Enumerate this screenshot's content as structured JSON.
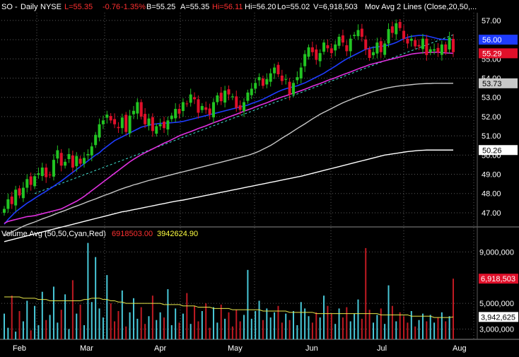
{
  "header": {
    "symbol": "SO",
    "period": "Daily",
    "exchange": "NYSE",
    "last": "L=55.35",
    "change": "-0.76",
    "change_pct": "-1.35%",
    "bid": "B=55.25",
    "ask": "A=55.35",
    "high": "Hi=56.11",
    "hi2": "Hi=56.20",
    "low": "Lo=55.02",
    "volume": "V=6,918,503",
    "mov_avg": "Mov Avg 2 Lines (Close,20,50,..."
  },
  "volume_header": {
    "label": "Volume Avg (50,50,Cyan,Red)",
    "value_red": "6918503.00",
    "value_yellow": "3942624.90"
  },
  "price_axis": {
    "ticks": [
      "57.00",
      "56.00",
      "55.00",
      "54.00",
      "53.00",
      "52.00",
      "51.00",
      "50.00",
      "49.00",
      "48.00",
      "47.00"
    ],
    "markers": [
      {
        "label": "56.00",
        "color": "#1e3cff"
      },
      {
        "label": "55.29",
        "color": "#e0102a"
      },
      {
        "label": "53.73",
        "color": "#c8c8c8"
      },
      {
        "label": "50.26",
        "color": "#ffffff"
      }
    ]
  },
  "volume_axis": {
    "ticks": [
      "9,000,000",
      "5,000,000",
      "3,000,000"
    ],
    "markers": [
      {
        "label": "6,918,503",
        "color": "#e0102a"
      },
      {
        "label": "3,942,625",
        "color": "#ffffff"
      }
    ]
  },
  "x_axis": {
    "labels": [
      "Feb",
      "Mar",
      "Apr",
      "May",
      "Jun",
      "Jul",
      "Aug"
    ]
  },
  "colors": {
    "up": "#22c422",
    "down": "#e0102a",
    "ma20": "#1e3cff",
    "ma50": "#e030e0",
    "ma100": "#c8c8c8",
    "ma200": "#ffffff",
    "trend": "#40e0d0",
    "vol_avg": "#e6e64a",
    "vol_up": "#48c8d8",
    "vol_down": "#c01a22",
    "grid": "#5a5a5a"
  },
  "chart_data": {
    "type": "candlestick",
    "price_range": [
      46.3,
      57.4
    ],
    "volume_range": [
      2200000,
      9900000
    ],
    "closes": [
      47.2,
      47.7,
      47.45,
      48.2,
      47.9,
      48.3,
      48.75,
      48.45,
      48.9,
      49.05,
      49.35,
      48.85,
      48.95,
      49.75,
      50.25,
      49.45,
      49.65,
      50.05,
      49.35,
      49.95,
      49.55,
      49.85,
      50.05,
      50.45,
      51.05,
      51.6,
      51.8,
      52.1,
      51.8,
      51.6,
      51.4,
      51.95,
      51.2,
      52.05,
      52.3,
      52.75,
      52.0,
      51.6,
      51.9,
      51.25,
      51.5,
      51.6,
      51.4,
      51.8,
      52.05,
      52.4,
      52.15,
      52.75,
      52.65,
      53.15,
      52.9,
      52.2,
      52.55,
      52.35,
      52.1,
      52.75,
      53.1,
      52.8,
      53.35,
      53.15,
      53.05,
      52.45,
      52.35,
      52.75,
      53.25,
      53.45,
      53.75,
      54.05,
      53.6,
      53.95,
      54.25,
      54.55,
      54.2,
      53.85,
      53.95,
      53.15,
      53.75,
      54.05,
      54.55,
      55.25,
      55.6,
      55.35,
      54.95,
      55.3,
      55.85,
      55.55,
      55.3,
      55.75,
      56.15,
      55.85,
      55.4,
      56.05,
      56.25,
      56.5,
      56.15,
      55.5,
      55.05,
      55.35,
      55.85,
      55.35,
      55.8,
      56.55,
      56.35,
      56.85,
      56.6,
      56.05,
      55.8,
      56.05,
      55.65,
      55.65,
      56.05,
      55.2,
      55.5,
      55.5,
      55.35,
      55.75,
      55.35,
      56.11,
      55.35
    ],
    "series": [
      {
        "name": "MA 20",
        "values": [
          46.4,
          46.65,
          46.85,
          47.05,
          47.2,
          47.35,
          47.5,
          47.62,
          47.75,
          47.88,
          48.0,
          48.12,
          48.25,
          48.38,
          48.52,
          48.65,
          48.8,
          48.95,
          49.1,
          49.25,
          49.4,
          49.55,
          49.7,
          49.85,
          50.0,
          50.12,
          50.3,
          50.45,
          50.6,
          50.75,
          50.85,
          50.95,
          51.05,
          51.15,
          51.25,
          51.35,
          51.45,
          51.5,
          51.55,
          51.6,
          51.62,
          51.65,
          51.65,
          51.67,
          51.68,
          51.7,
          51.72,
          51.75,
          51.8,
          51.85,
          51.9,
          51.95,
          52.0,
          52.05,
          52.1,
          52.15,
          52.2,
          52.25,
          52.3,
          52.35,
          52.4,
          52.45,
          52.5,
          52.55,
          52.6,
          52.68,
          52.75,
          52.82,
          52.9,
          53.0,
          53.1,
          53.2,
          53.3,
          53.38,
          53.45,
          53.5,
          53.55,
          53.6,
          53.68,
          53.75,
          53.85,
          53.95,
          54.05,
          54.15,
          54.25,
          54.38,
          54.5,
          54.62,
          54.75,
          54.88,
          55.0,
          55.1,
          55.2,
          55.3,
          55.4,
          55.5,
          55.55,
          55.6,
          55.62,
          55.65,
          55.68,
          55.72,
          55.78,
          55.85,
          55.95,
          56.05,
          56.12,
          56.17,
          56.2,
          56.22,
          56.22,
          56.2,
          56.15,
          56.1,
          56.05,
          56.02,
          56.0,
          56.0,
          56.0
        ]
      },
      {
        "name": "MA 50",
        "values": [
          46.45,
          46.55,
          46.6,
          46.65,
          46.7,
          46.75,
          46.8,
          46.82,
          46.85,
          46.9,
          46.95,
          47.0,
          47.05,
          47.1,
          47.15,
          47.2,
          47.3,
          47.4,
          47.5,
          47.6,
          47.72,
          47.85,
          48.0,
          48.15,
          48.3,
          48.45,
          48.6,
          48.75,
          48.9,
          49.05,
          49.2,
          49.35,
          49.5,
          49.65,
          49.78,
          49.9,
          50.02,
          50.12,
          50.22,
          50.32,
          50.42,
          50.52,
          50.62,
          50.7,
          50.8,
          50.9,
          51.0,
          51.08,
          51.15,
          51.22,
          51.3,
          51.38,
          51.45,
          51.52,
          51.6,
          51.68,
          51.75,
          51.82,
          51.9,
          51.98,
          52.05,
          52.12,
          52.2,
          52.28,
          52.35,
          52.42,
          52.5,
          52.58,
          52.65,
          52.72,
          52.8,
          52.88,
          52.95,
          53.02,
          53.08,
          53.15,
          53.22,
          53.28,
          53.35,
          53.42,
          53.5,
          53.58,
          53.65,
          53.72,
          53.8,
          53.88,
          53.95,
          54.02,
          54.1,
          54.18,
          54.25,
          54.32,
          54.4,
          54.48,
          54.55,
          54.62,
          54.7,
          54.75,
          54.8,
          54.85,
          54.9,
          54.95,
          55.0,
          55.05,
          55.1,
          55.15,
          55.2,
          55.25,
          55.28,
          55.3,
          55.32,
          55.33,
          55.34,
          55.35,
          55.35,
          55.33,
          55.31,
          55.3,
          55.29
        ]
      },
      {
        "name": "MA 100",
        "values": [
          45.8,
          45.9,
          46.0,
          46.1,
          46.2,
          46.3,
          46.38,
          46.45,
          46.52,
          46.6,
          46.68,
          46.75,
          46.82,
          46.9,
          46.98,
          47.05,
          47.12,
          47.2,
          47.28,
          47.35,
          47.42,
          47.5,
          47.58,
          47.65,
          47.72,
          47.8,
          47.88,
          47.95,
          48.02,
          48.1,
          48.18,
          48.25,
          48.32,
          48.38,
          48.45,
          48.5,
          48.56,
          48.62,
          48.68,
          48.73,
          48.78,
          48.83,
          48.88,
          48.93,
          48.98,
          49.03,
          49.08,
          49.13,
          49.18,
          49.23,
          49.28,
          49.33,
          49.38,
          49.43,
          49.48,
          49.53,
          49.58,
          49.63,
          49.68,
          49.73,
          49.78,
          49.83,
          49.88,
          49.93,
          49.98,
          50.05,
          50.12,
          50.2,
          50.3,
          50.4,
          50.5,
          50.62,
          50.75,
          50.88,
          51.0,
          51.12,
          51.25,
          51.38,
          51.5,
          51.62,
          51.75,
          51.88,
          52.0,
          52.12,
          52.22,
          52.32,
          52.42,
          52.52,
          52.62,
          52.72,
          52.8,
          52.88,
          52.96,
          53.04,
          53.1,
          53.17,
          53.24,
          53.3,
          53.36,
          53.41,
          53.46,
          53.5,
          53.54,
          53.57,
          53.6,
          53.62,
          53.64,
          53.66,
          53.68,
          53.7,
          53.71,
          53.72,
          53.72,
          53.73,
          53.73,
          53.73,
          53.73,
          53.73,
          53.73
        ]
      },
      {
        "name": "MA 200",
        "values": [
          45.5,
          45.55,
          45.6,
          45.65,
          45.7,
          45.75,
          45.8,
          45.85,
          45.9,
          45.95,
          46.0,
          46.05,
          46.1,
          46.15,
          46.2,
          46.25,
          46.3,
          46.35,
          46.4,
          46.45,
          46.5,
          46.55,
          46.6,
          46.65,
          46.7,
          46.75,
          46.8,
          46.85,
          46.9,
          46.95,
          47.0,
          47.05,
          47.08,
          47.12,
          47.16,
          47.2,
          47.24,
          47.28,
          47.32,
          47.36,
          47.4,
          47.44,
          47.48,
          47.52,
          47.56,
          47.6,
          47.63,
          47.66,
          47.7,
          47.74,
          47.78,
          47.82,
          47.86,
          47.9,
          47.94,
          47.98,
          48.02,
          48.06,
          48.1,
          48.14,
          48.18,
          48.22,
          48.26,
          48.3,
          48.34,
          48.38,
          48.42,
          48.46,
          48.5,
          48.54,
          48.58,
          48.62,
          48.66,
          48.7,
          48.74,
          48.78,
          48.82,
          48.86,
          48.9,
          48.95,
          49.0,
          49.05,
          49.1,
          49.15,
          49.2,
          49.25,
          49.3,
          49.35,
          49.4,
          49.45,
          49.5,
          49.55,
          49.6,
          49.65,
          49.7,
          49.75,
          49.8,
          49.85,
          49.9,
          49.95,
          50.0,
          50.03,
          50.06,
          50.09,
          50.12,
          50.15,
          50.18,
          50.2,
          50.22,
          50.24,
          50.25,
          50.26,
          50.26,
          50.26,
          50.26,
          50.26,
          50.26,
          50.26,
          50.26
        ]
      }
    ],
    "volume": [
      4.2,
      3.1,
      5.6,
      2.8,
      4.4,
      3.6,
      5.2,
      2.9,
      4.8,
      3.3,
      5.9,
      3.7,
      4.1,
      6.3,
      3.5,
      4.5,
      5.7,
      3.0,
      6.8,
      4.2,
      4.9,
      3.3,
      9.7,
      5.1,
      8.6,
      4.6,
      3.9,
      7.2,
      5.0,
      3.6,
      4.4,
      6.0,
      3.2,
      4.3,
      5.4,
      3.8,
      4.7,
      3.4,
      4.0,
      5.6,
      3.7,
      4.3,
      3.9,
      6.1,
      3.3,
      4.6,
      3.5,
      4.2,
      5.8,
      3.4,
      4.8,
      3.6,
      4.4,
      5.0,
      3.1,
      4.7,
      3.5,
      4.9,
      3.8,
      4.3,
      3.2,
      4.5,
      3.6,
      4.1,
      7.6,
      3.8,
      4.4,
      5.2,
      3.7,
      4.6,
      3.9,
      4.3,
      4.8,
      3.5,
      4.2,
      3.7,
      4.4,
      3.3,
      5.1,
      4.6,
      4.0,
      3.5,
      4.3,
      3.9,
      5.6,
      4.8,
      4.2,
      3.4,
      4.6,
      3.9,
      4.7,
      3.6,
      4.2,
      5.3,
      3.8,
      9.3,
      4.5,
      3.5,
      4.1,
      4.6,
      3.4,
      6.4,
      4.8,
      3.6,
      4.3,
      4.0,
      3.5,
      4.4,
      3.2,
      3.7,
      4.2,
      3.6,
      4.1,
      3.5,
      3.9,
      4.3,
      3.6,
      4.0,
      6.92
    ],
    "volume_avg": [
      5.5,
      5.5,
      5.5,
      5.5,
      5.5,
      5.4,
      5.4,
      5.4,
      5.4,
      5.3,
      5.3,
      5.3,
      5.2,
      5.2,
      5.2,
      5.2,
      5.2,
      5.2,
      5.2,
      5.2,
      5.2,
      5.3,
      5.3,
      5.4,
      5.4,
      5.4,
      5.3,
      5.3,
      5.2,
      5.2,
      5.1,
      5.1,
      5.0,
      5.0,
      5.0,
      5.0,
      5.0,
      5.0,
      5.0,
      5.0,
      5.0,
      5.0,
      4.9,
      4.9,
      4.9,
      4.9,
      4.9,
      4.8,
      4.8,
      4.8,
      4.8,
      4.7,
      4.7,
      4.7,
      4.7,
      4.6,
      4.6,
      4.6,
      4.6,
      4.6,
      4.5,
      4.5,
      4.5,
      4.5,
      4.5,
      4.5,
      4.5,
      4.5,
      4.4,
      4.4,
      4.4,
      4.4,
      4.4,
      4.4,
      4.4,
      4.3,
      4.3,
      4.3,
      4.3,
      4.3,
      4.3,
      4.3,
      4.2,
      4.2,
      4.2,
      4.2,
      4.2,
      4.2,
      4.2,
      4.2,
      4.2,
      4.2,
      4.2,
      4.2,
      4.2,
      4.2,
      4.2,
      4.2,
      4.2,
      4.1,
      4.1,
      4.1,
      4.1,
      4.1,
      4.1,
      4.1,
      4.1,
      4.0,
      4.0,
      4.0,
      4.0,
      4.0,
      4.0,
      3.9,
      3.9,
      3.9,
      3.9,
      3.9,
      3.94
    ]
  }
}
